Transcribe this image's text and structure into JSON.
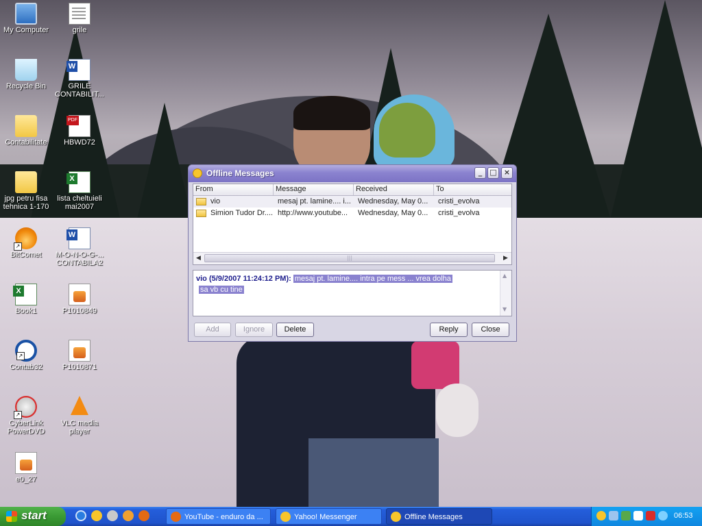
{
  "desktop": {
    "icons": [
      {
        "label": "My Computer",
        "icon": "my-computer-icon"
      },
      {
        "label": "grile",
        "icon": "document-icon"
      },
      {
        "label": "Recycle Bin",
        "icon": "recycle-bin-icon"
      },
      {
        "label": "GRILE CONTABILIT...",
        "icon": "word-document-icon"
      },
      {
        "label": "Contabilitate",
        "icon": "folder-icon"
      },
      {
        "label": "HBWD72",
        "icon": "pdf-icon"
      },
      {
        "label": "jpg petru fisa tehnica 1-170",
        "icon": "folder-icon"
      },
      {
        "label": "lista cheltuieli mai2007",
        "icon": "excel-document-icon"
      },
      {
        "label": "BitComet",
        "icon": "bitcomet-icon"
      },
      {
        "label": "M-O-N-O-G-... CONTABILA2",
        "icon": "word-document-icon"
      },
      {
        "label": "Book1",
        "icon": "excel-document-icon"
      },
      {
        "label": "P1010849",
        "icon": "image-file-icon"
      },
      {
        "label": "Contab32",
        "icon": "contab-icon"
      },
      {
        "label": "P1010871",
        "icon": "image-file-icon"
      },
      {
        "label": "CyberLink PowerDVD",
        "icon": "powerdvd-icon"
      },
      {
        "label": "VLC media player",
        "icon": "vlc-icon"
      },
      {
        "label": "e0_27",
        "icon": "image-file-icon"
      }
    ]
  },
  "window": {
    "title": "Offline Messages",
    "controls": {
      "minimize": "_",
      "maximize": "□",
      "close": "×"
    },
    "list": {
      "columns": [
        "From",
        "Message",
        "Received",
        "To"
      ],
      "rows": [
        {
          "from": "vio",
          "message": "mesaj pt. lamine.... i...",
          "received": "Wednesday, May 0...",
          "to": "cristi_evolva"
        },
        {
          "from": "Simion Tudor Dr....",
          "message": "http://www.youtube...",
          "received": "Wednesday, May 0...",
          "to": "cristi_evolva"
        }
      ]
    },
    "message": {
      "sender": "vio (5/9/2007 11:24:12 PM):",
      "body_line1": "mesaj pt. lamine.... intra pe mess ... vrea dolha",
      "body_line2": "sa vb cu tine"
    },
    "buttons": {
      "add": "Add",
      "ignore": "Ignore",
      "delete": "Delete",
      "reply": "Reply",
      "close": "Close"
    }
  },
  "taskbar": {
    "start_label": "start",
    "tasks": [
      {
        "label": "YouTube - enduro da ..."
      },
      {
        "label": "Yahoo! Messenger"
      },
      {
        "label": "Offline Messages"
      }
    ],
    "clock": "06:53"
  }
}
